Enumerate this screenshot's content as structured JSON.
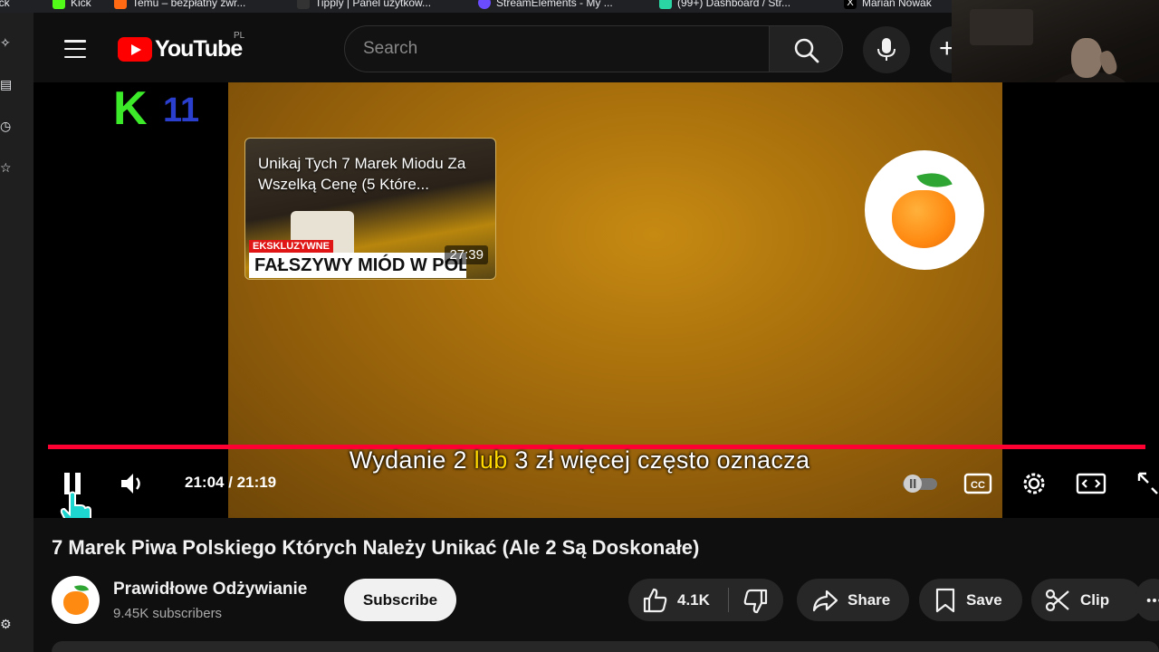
{
  "browser": {
    "bookmarks": [
      {
        "label": "Kick",
        "color": "#53fc18"
      },
      {
        "label": "Kick",
        "color": "#53fc18"
      },
      {
        "label": "Temu – bezpłatny zwr...",
        "color": "#ff6a13"
      },
      {
        "label": "Tipply | Panel użytkow...",
        "color": "#000000"
      },
      {
        "label": "StreamElements - My ...",
        "color": "#6b4dff"
      },
      {
        "label": "(99+) Dashboard / Str...",
        "color": "#2bd6a5"
      },
      {
        "label": "Marian Nowak",
        "color": "#000000"
      }
    ]
  },
  "header": {
    "logo_text": "YouTube",
    "country_code": "PL",
    "search_placeholder": "Search",
    "create_symbol": "+"
  },
  "player": {
    "channel_badge_letter": "K",
    "channel_badge_number": "11",
    "endcard": {
      "title": "Unikaj Tych 7 Marek Miodu Za Wszelką Cenę (5 Które...",
      "badge": "EKSKLUZYWNE",
      "banner": "FAŁSZYWY MIÓD W POLSCE",
      "duration": "27:39"
    },
    "subtitle_before": "Wydanie 2 ",
    "subtitle_highlight": "lub",
    "subtitle_after": " 3 zł więcej często oznacza",
    "current_time": "21:04",
    "separator": " / ",
    "total_time": "21:19",
    "progress_fraction": 0.988,
    "accent_color": "#ff0033"
  },
  "video": {
    "title": "7 Marek Piwa Polskiego Których Należy Unikać (Ale 2 Są Doskonałe)",
    "channel_name": "Prawidłowe Odżywianie",
    "subscribers": "9.45K subscribers",
    "subscribe_label": "Subscribe",
    "likes": "4.1K",
    "share_label": "Share",
    "save_label": "Save",
    "clip_label": "Clip"
  }
}
